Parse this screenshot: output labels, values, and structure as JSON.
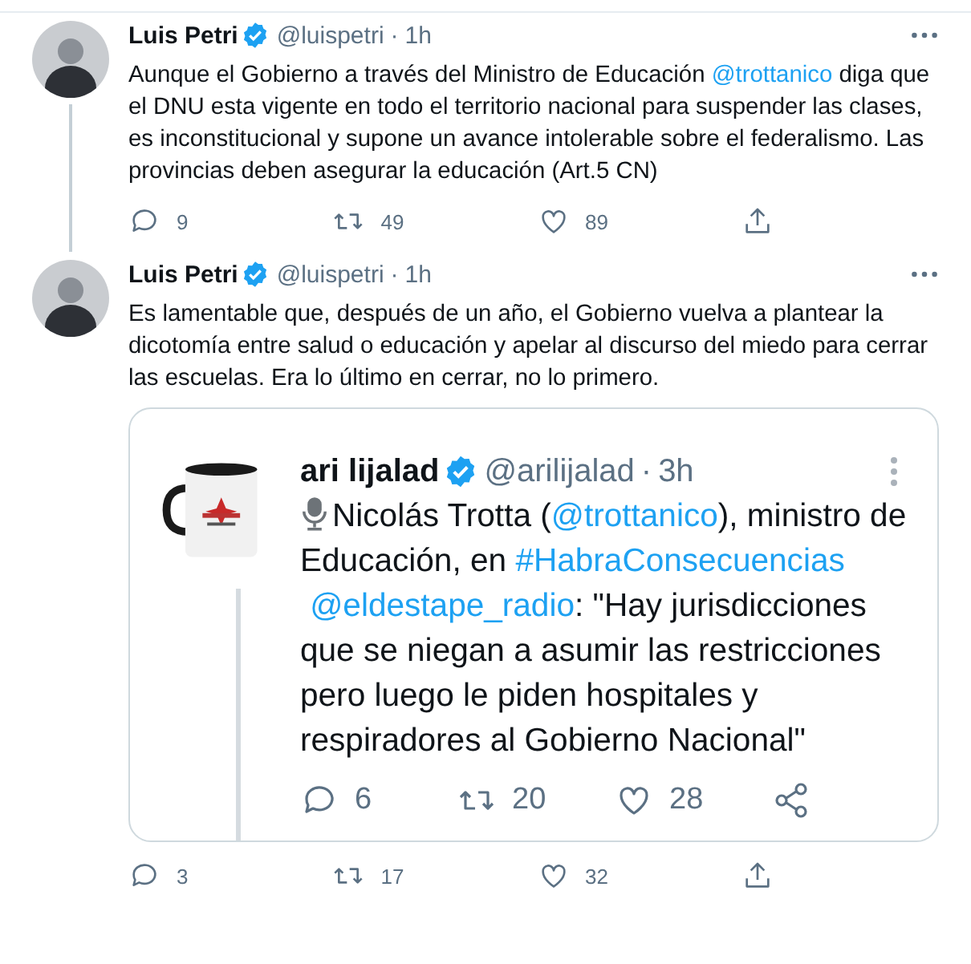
{
  "tweets": [
    {
      "author": {
        "name": "Luis Petri",
        "handle": "@luispetri",
        "separator": "·",
        "time": "1h",
        "verified": true
      },
      "thread_continues": true,
      "text": [
        {
          "kind": "text",
          "text": "Aunque el Gobierno a través del Ministro de Educación "
        },
        {
          "kind": "link",
          "text": "@trottanico"
        },
        {
          "kind": "text",
          "text": " diga que el DNU esta vigente en todo el territorio nacional para suspender las clases, es inconstitucional y supone un avance intolerable sobre el federalismo. Las provincias deben asegurar la educación (Art.5 CN)"
        }
      ],
      "actions": [
        {
          "kind": "reply",
          "count": "9"
        },
        {
          "kind": "retweet",
          "count": "49"
        },
        {
          "kind": "like",
          "count": "89"
        },
        {
          "kind": "share"
        }
      ]
    },
    {
      "author": {
        "name": "Luis Petri",
        "handle": "@luispetri",
        "separator": "·",
        "time": "1h",
        "verified": true
      },
      "thread_continues": false,
      "text": [
        {
          "kind": "text",
          "text": "Es lamentable que, después de un año, el Gobierno vuelva a plantear la dicotomía entre salud o educación y apelar al discurso del miedo para cerrar las escuelas. Era lo último en cerrar, no lo primero."
        }
      ],
      "embedded_screenshot": {
        "author": {
          "name": "ari lijalad",
          "handle": "@arilijalad",
          "separator": "·",
          "time": "3h",
          "verified": true
        },
        "text": [
          {
            "kind": "text",
            "text": "Nicolás Trotta ("
          },
          {
            "kind": "link",
            "text": "@trottanico"
          },
          {
            "kind": "text",
            "text": "), ministro de Educación, en "
          },
          {
            "kind": "link",
            "text": "#HabraConsecuencias"
          },
          {
            "kind": "link",
            "text": "@eldestape_radio"
          },
          {
            "kind": "text",
            "text": ": \"Hay jurisdicciones que se niegan a asumir las restricciones pero luego le piden hospitales y respiradores al Gobierno Nacional\""
          }
        ],
        "actions": [
          {
            "kind": "reply",
            "count": "6"
          },
          {
            "kind": "retweet",
            "count": "20"
          },
          {
            "kind": "like",
            "count": "28"
          },
          {
            "kind": "share"
          }
        ]
      },
      "actions": [
        {
          "kind": "reply",
          "count": "3"
        },
        {
          "kind": "retweet",
          "count": "17"
        },
        {
          "kind": "like",
          "count": "32"
        },
        {
          "kind": "share"
        }
      ]
    }
  ]
}
